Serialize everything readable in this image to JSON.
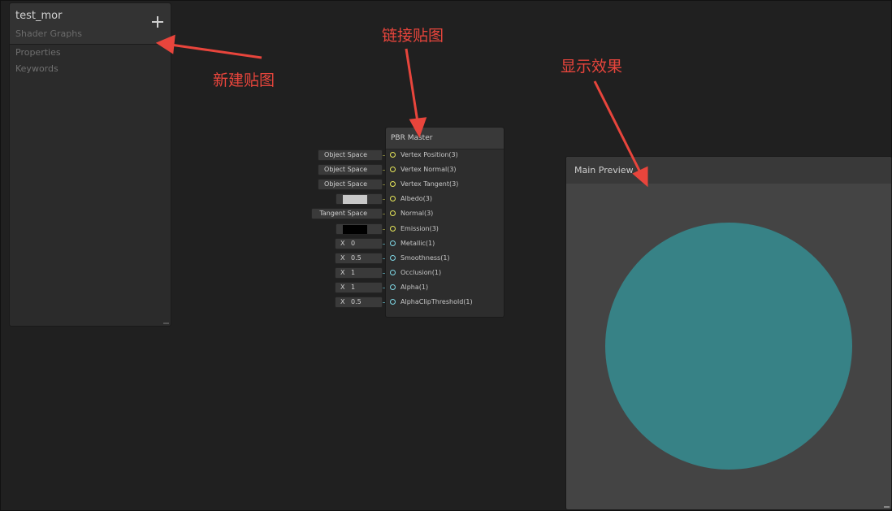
{
  "blackboard": {
    "title": "test_mor",
    "subtitle": "Shader Graphs",
    "sections": [
      "Properties",
      "Keywords"
    ]
  },
  "master_node": {
    "title": "PBR Master",
    "ports": [
      {
        "label": "Vertex Position(3)",
        "kind": "vec3"
      },
      {
        "label": "Vertex Normal(3)",
        "kind": "vec3"
      },
      {
        "label": "Vertex Tangent(3)",
        "kind": "vec3"
      },
      {
        "label": "Albedo(3)",
        "kind": "vec3"
      },
      {
        "label": "Normal(3)",
        "kind": "vec3"
      },
      {
        "label": "Emission(3)",
        "kind": "vec3"
      },
      {
        "label": "Metallic(1)",
        "kind": "float"
      },
      {
        "label": "Smoothness(1)",
        "kind": "float"
      },
      {
        "label": "Occlusion(1)",
        "kind": "float"
      },
      {
        "label": "Alpha(1)",
        "kind": "float"
      },
      {
        "label": "AlphaClipThreshold(1)",
        "kind": "float"
      }
    ],
    "inputs": [
      {
        "type": "space",
        "value": "Object Space"
      },
      {
        "type": "space",
        "value": "Object Space"
      },
      {
        "type": "space",
        "value": "Object Space"
      },
      {
        "type": "color",
        "value": "#c8c8c8"
      },
      {
        "type": "space",
        "value": "Tangent Space"
      },
      {
        "type": "color",
        "value": "#000000"
      },
      {
        "type": "float",
        "axis": "X",
        "value": "0"
      },
      {
        "type": "float",
        "axis": "X",
        "value": "0.5"
      },
      {
        "type": "float",
        "axis": "X",
        "value": "1"
      },
      {
        "type": "float",
        "axis": "X",
        "value": "1"
      },
      {
        "type": "float",
        "axis": "X",
        "value": "0.5"
      }
    ]
  },
  "main_preview": {
    "title": "Main Preview",
    "sphere_color": "#378286"
  },
  "annotations": {
    "new_texture": "新建贴图",
    "link_texture": "链接贴图",
    "show_effect": "显示效果",
    "color": "#e8453c"
  }
}
